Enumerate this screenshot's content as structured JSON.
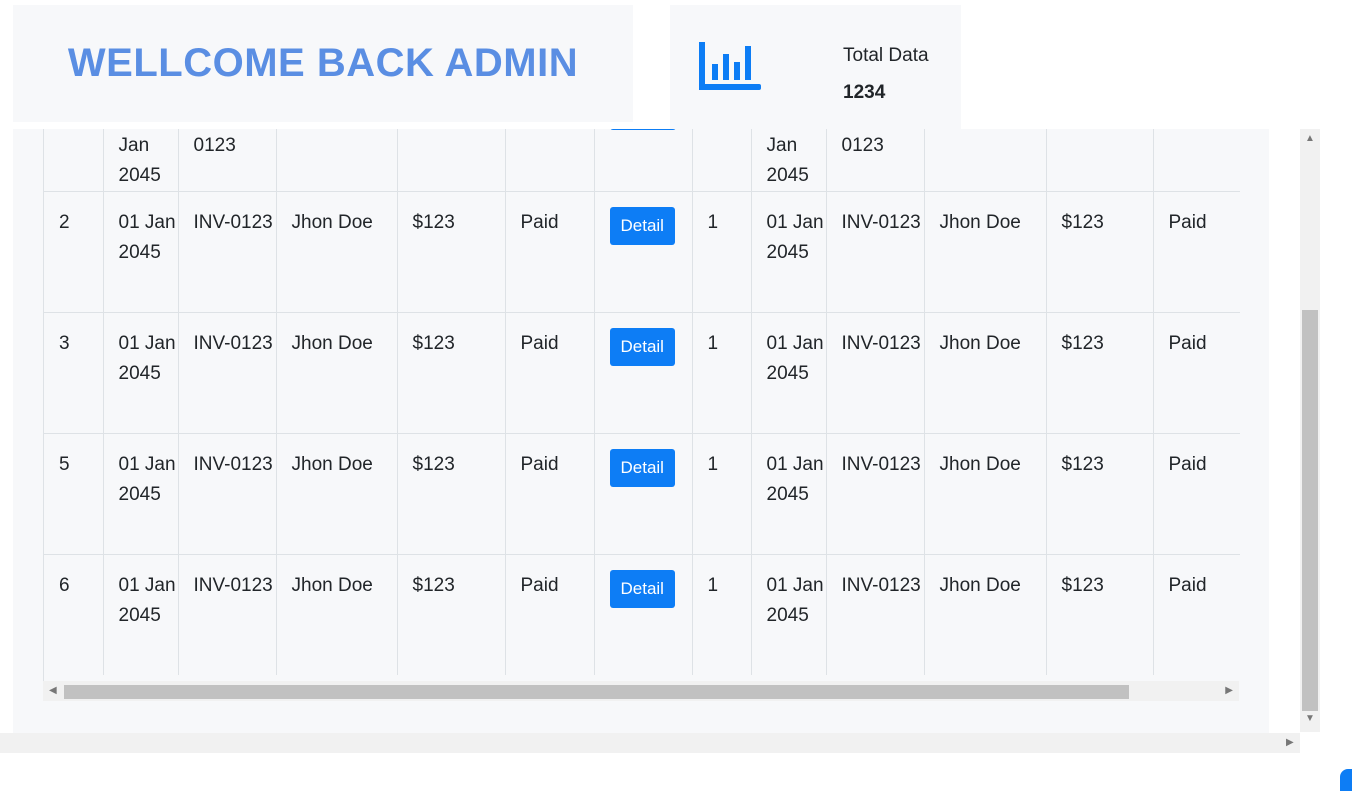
{
  "welcome": {
    "title": "WELLCOME BACK ADMIN"
  },
  "stats": {
    "label": "Total Data",
    "value": "1234",
    "icon": "bar-chart-icon"
  },
  "table": {
    "rows": [
      {
        "no": "",
        "date": "Jan 2045",
        "invoice": "0123",
        "customer": "",
        "amount": "",
        "status": "",
        "qty": "",
        "date2": "Jan 2045",
        "invoice2": "0123",
        "customer2": "",
        "amount2": "",
        "status2": "",
        "detail_visible": "partial"
      },
      {
        "no": "2",
        "date": "01 Jan 2045",
        "invoice": "INV-0123",
        "customer": "Jhon Doe",
        "amount": "$123",
        "status": "Paid",
        "detail": "Detail",
        "qty": "1",
        "date2": "01 Jan 2045",
        "invoice2": "INV-0123",
        "customer2": "Jhon Doe",
        "amount2": "$123",
        "status2": "Paid"
      },
      {
        "no": "3",
        "date": "01 Jan 2045",
        "invoice": "INV-0123",
        "customer": "Jhon Doe",
        "amount": "$123",
        "status": "Paid",
        "detail": "Detail",
        "qty": "1",
        "date2": "01 Jan 2045",
        "invoice2": "INV-0123",
        "customer2": "Jhon Doe",
        "amount2": "$123",
        "status2": "Paid"
      },
      {
        "no": "5",
        "date": "01 Jan 2045",
        "invoice": "INV-0123",
        "customer": "Jhon Doe",
        "amount": "$123",
        "status": "Paid",
        "detail": "Detail",
        "qty": "1",
        "date2": "01 Jan 2045",
        "invoice2": "INV-0123",
        "customer2": "Jhon Doe",
        "amount2": "$123",
        "status2": "Paid"
      },
      {
        "no": "6",
        "date": "01 Jan 2045",
        "invoice": "INV-0123",
        "customer": "Jhon Doe",
        "amount": "$123",
        "status": "Paid",
        "detail": "Detail",
        "qty": "1",
        "date2": "01 Jan 2045",
        "invoice2": "INV-0123",
        "customer2": "Jhon Doe",
        "amount2": "$123",
        "status2": "Paid"
      }
    ]
  },
  "colors": {
    "accent": "#0d7df5",
    "title": "#5a8ee3",
    "panel": "#f7f8fa"
  }
}
